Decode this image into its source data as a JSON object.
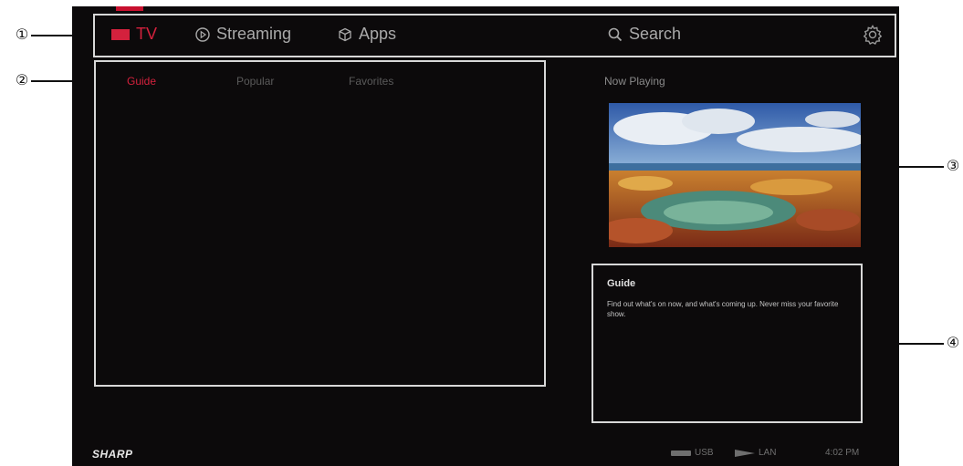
{
  "callouts": [
    "①",
    "②",
    "③",
    "④"
  ],
  "nav": {
    "tv": "TV",
    "streaming": "Streaming",
    "apps": "Apps",
    "search": "Search"
  },
  "tabs": {
    "guide": "Guide",
    "popular": "Popular",
    "favorites": "Favorites"
  },
  "now_playing": "Now Playing",
  "info": {
    "title": "Guide",
    "description": "Find out what's on now, and what's coming up. Never miss your favorite show."
  },
  "footer": {
    "brand": "SHARP",
    "usb": "USB",
    "lan": "LAN",
    "time": "4:02 PM"
  },
  "colors": {
    "accent": "#d4213d",
    "background": "#0c0a0b"
  }
}
